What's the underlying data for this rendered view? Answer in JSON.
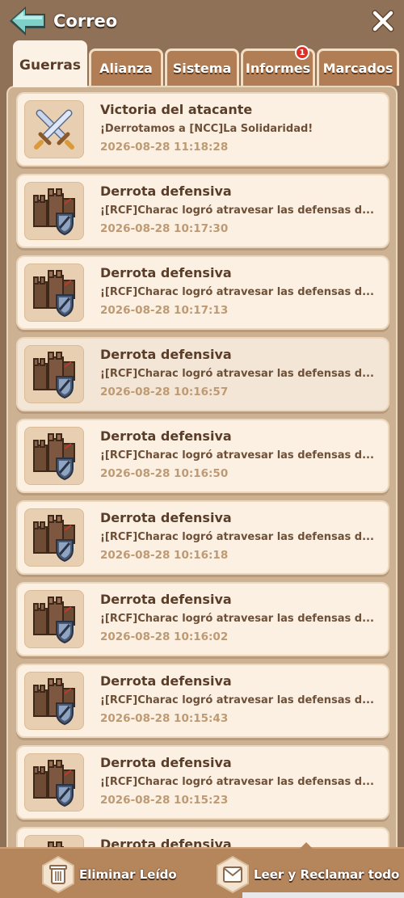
{
  "header": {
    "title": "Correo"
  },
  "tabs": [
    {
      "label": "Guerras",
      "active": true
    },
    {
      "label": "Alianza"
    },
    {
      "label": "Sistema"
    },
    {
      "label": "Informes",
      "badge": "1"
    },
    {
      "label": "Marcados"
    }
  ],
  "mails": [
    {
      "type": "victory",
      "title": "Victoria del atacante",
      "text": "¡Derrotamos a [NCC]La Solidaridad!",
      "time": "2026-08-28 11:18:28"
    },
    {
      "type": "defense",
      "title": "Derrota defensiva",
      "text": "¡[RCF]Charac logró atravesar las defensas d...",
      "time": "2026-08-28 10:17:30"
    },
    {
      "type": "defense",
      "title": "Derrota defensiva",
      "text": "¡[RCF]Charac logró atravesar las defensas d...",
      "time": "2026-08-28 10:17:13"
    },
    {
      "type": "defense",
      "title": "Derrota defensiva",
      "text": "¡[RCF]Charac logró atravesar las defensas d...",
      "time": "2026-08-28 10:16:57"
    },
    {
      "type": "defense",
      "title": "Derrota defensiva",
      "text": "¡[RCF]Charac logró atravesar las defensas d...",
      "time": "2026-08-28 10:16:50"
    },
    {
      "type": "defense",
      "title": "Derrota defensiva",
      "text": "¡[RCF]Charac logró atravesar las defensas d...",
      "time": "2026-08-28 10:16:18"
    },
    {
      "type": "defense",
      "title": "Derrota defensiva",
      "text": "¡[RCF]Charac logró atravesar las defensas d...",
      "time": "2026-08-28 10:16:02"
    },
    {
      "type": "defense",
      "title": "Derrota defensiva",
      "text": "¡[RCF]Charac logró atravesar las defensas d...",
      "time": "2026-08-28 10:15:43"
    },
    {
      "type": "defense",
      "title": "Derrota defensiva",
      "text": "¡[RCF]Charac logró atravesar las defensas d...",
      "time": "2026-08-28 10:15:23"
    },
    {
      "type": "defense",
      "title": "Derrota defensiva",
      "text": "",
      "time": ""
    }
  ],
  "footer": {
    "delete_read_label": "Eliminar Leído",
    "read_claim_all_label": "Leer y Reclamar todo"
  },
  "colors": {
    "background": "#8f7158",
    "card": "#fbf0e2",
    "accent": "#b07d55",
    "badge": "#d8322a"
  }
}
